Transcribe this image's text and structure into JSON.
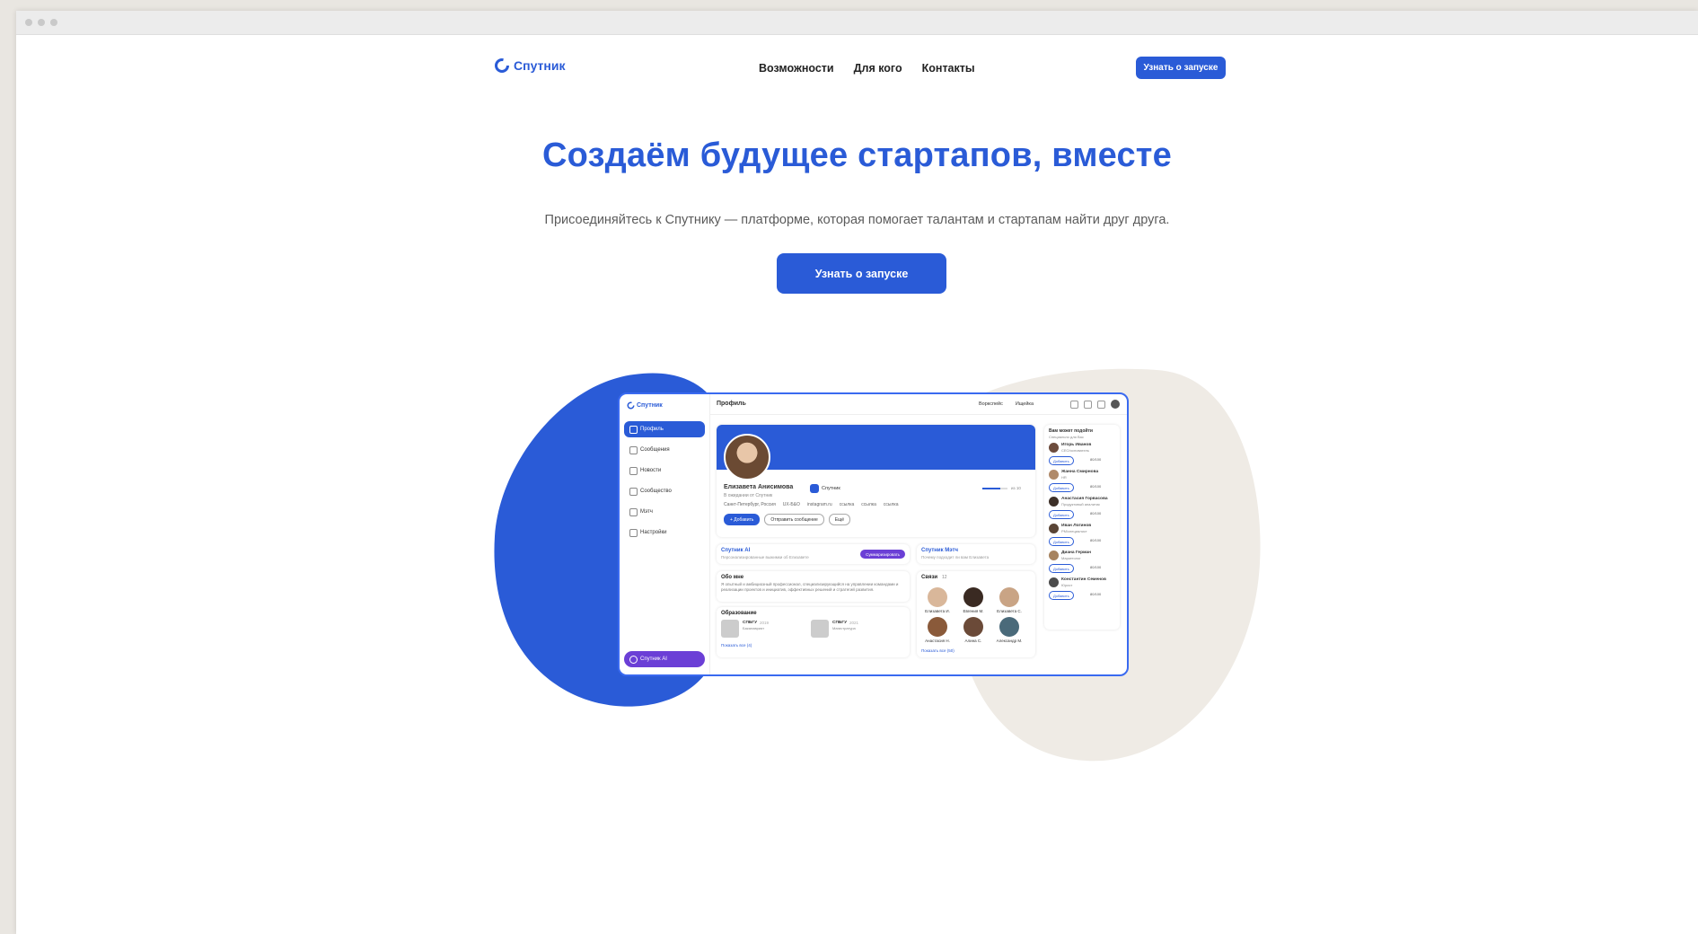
{
  "window": {
    "controls": [
      "close",
      "minimize",
      "maximize"
    ]
  },
  "header": {
    "logo_text": "Спутник",
    "nav": [
      "Возможности",
      "Для кого",
      "Контакты"
    ],
    "cta_label": "Узнать о запуске"
  },
  "hero": {
    "title": "Создаём будущее стартапов, вместе",
    "subtitle": "Присоединяйтесь к Спутнику — платформе, которая помогает талантам и стартапам найти друг друга.",
    "cta_label": "Узнать о запуске"
  },
  "colors": {
    "accent": "#2a5bd7",
    "beige": "#efebe5",
    "purple": "#6b3fd6"
  },
  "mockup": {
    "logo_text": "Спутник",
    "page_title": "Профиль",
    "top_links": [
      "Воркспейс",
      "Ищейка"
    ],
    "sidebar": [
      "Профиль",
      "Сообщения",
      "Новости",
      "Сообщество",
      "Мэтч",
      "Настройки"
    ],
    "ai_button": "Спутник AI",
    "profile": {
      "name": "Елизавета Анисимова",
      "org": "Спутник",
      "role": "В ожидании от Спутник",
      "contacts": [
        "Санкт-Петербург, Россия",
        "UX-Б&О",
        "instagram.ru",
        "ссылка",
        "ссылка",
        "ссылка"
      ],
      "progress_label": "из 10",
      "progress_value": 0.7,
      "actions": [
        "+ Добавить",
        "Отправить сообщение",
        "Ещё"
      ]
    },
    "ai_card": {
      "title": "Спутник AI",
      "sub": "Персонализированные выжимки об Елизавете",
      "button": "Суммаризировать"
    },
    "match_card": {
      "title": "Спутник Мэтч",
      "sub": "Почему подходит ли вам Елизавета"
    },
    "about": {
      "title": "Обо мне",
      "text": "Я опытный и амбициозный профессионал, специализирующийся на управлении командами и реализации проектов и инициатив, эффективных решений и стратегий развития."
    },
    "education": {
      "title": "Образование",
      "items": [
        {
          "name": "СПБГУ",
          "year": "2019",
          "degree": "Бакалавриат"
        },
        {
          "name": "СПБГУ",
          "year": "2021",
          "degree": "Магистратура"
        }
      ],
      "more": "Показать все (4)"
    },
    "connections": {
      "title": "Связи",
      "count": "12",
      "people": [
        "Елизавета И.",
        "Евгения М.",
        "Елизавета С.",
        "Анастасия Н.",
        "Алина С.",
        "Александр М."
      ],
      "more": "Показать все (50)"
    },
    "suggestions": {
      "title": "Вам может подойти",
      "sub": "Специально для Вас",
      "add_label": "Добавить",
      "people": [
        {
          "name": "Игорь Иванов",
          "role": "CEO/основатель",
          "score": "80/100"
        },
        {
          "name": "Жанна Смирнова",
          "role": "HR",
          "score": "80/100"
        },
        {
          "name": "Анастасия Горвасова",
          "role": "Продуктовый аналитик",
          "score": "80/100"
        },
        {
          "name": "Иван Логинов",
          "role": "PM/специалист",
          "score": "80/100"
        },
        {
          "name": "Диана Герман",
          "role": "Маркетолог",
          "score": "80/100"
        },
        {
          "name": "Константин Семенов",
          "role": "Юрист",
          "score": "80/100"
        }
      ]
    }
  }
}
